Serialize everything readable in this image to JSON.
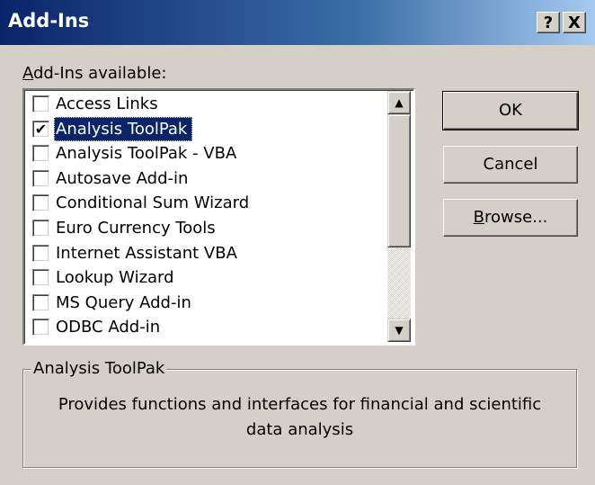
{
  "window": {
    "title": "Add-Ins",
    "help_glyph": "?",
    "close_glyph": "X"
  },
  "list": {
    "label_accel": "A",
    "label_rest": "dd-Ins available:",
    "items": [
      {
        "label": "Access Links",
        "checked": false,
        "selected": false
      },
      {
        "label": "Analysis ToolPak",
        "checked": true,
        "selected": true
      },
      {
        "label": "Analysis ToolPak - VBA",
        "checked": false,
        "selected": false
      },
      {
        "label": "Autosave Add-in",
        "checked": false,
        "selected": false
      },
      {
        "label": "Conditional Sum Wizard",
        "checked": false,
        "selected": false
      },
      {
        "label": "Euro Currency Tools",
        "checked": false,
        "selected": false
      },
      {
        "label": "Internet Assistant VBA",
        "checked": false,
        "selected": false
      },
      {
        "label": "Lookup Wizard",
        "checked": false,
        "selected": false
      },
      {
        "label": "MS Query Add-in",
        "checked": false,
        "selected": false
      },
      {
        "label": "ODBC Add-in",
        "checked": false,
        "selected": false
      }
    ],
    "check_glyph": "✔"
  },
  "buttons": {
    "ok": "OK",
    "cancel": "Cancel",
    "browse_accel": "B",
    "browse_rest": "rowse..."
  },
  "description": {
    "title": "Analysis ToolPak",
    "line1": "Provides functions and interfaces for financial and scientific",
    "line2": "data analysis"
  },
  "colors": {
    "title_start": "#0a246a",
    "selection": "#0a246a",
    "face": "#d4d0c8"
  }
}
